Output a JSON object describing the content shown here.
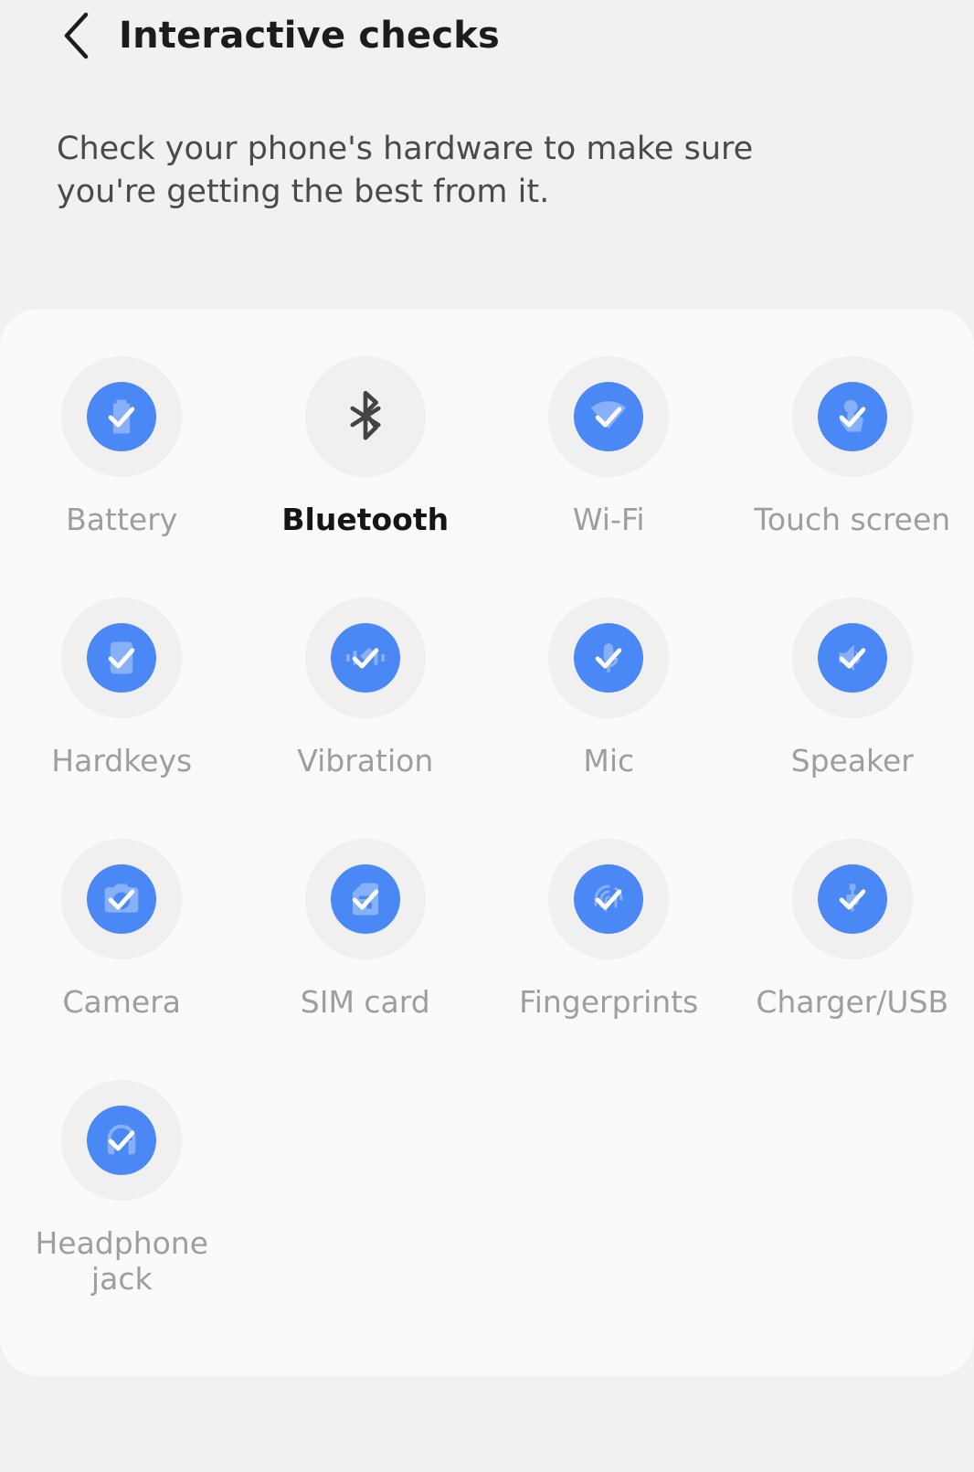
{
  "header": {
    "back_icon": "chevron-left-icon",
    "title": "Interactive checks"
  },
  "description": "Check your phone's hardware to make sure you're getting the best from it.",
  "colors": {
    "page_background": "#f1f1f1",
    "card_background": "#fafafa",
    "badge_blue": "#4a88f5",
    "disc_grey": "#f0f0f0",
    "label_done": "#9e9e9e",
    "label_pending": "#151515",
    "bluetooth_glyph": "#444444"
  },
  "checks": [
    {
      "label": "Battery",
      "icon": "battery-icon",
      "status": "done"
    },
    {
      "label": "Bluetooth",
      "icon": "bluetooth-icon",
      "status": "pending"
    },
    {
      "label": "Wi-Fi",
      "icon": "wifi-icon",
      "status": "done"
    },
    {
      "label": "Touch screen",
      "icon": "touch-screen-icon",
      "status": "done"
    },
    {
      "label": "Hardkeys",
      "icon": "hardkeys-icon",
      "status": "done"
    },
    {
      "label": "Vibration",
      "icon": "vibration-icon",
      "status": "done"
    },
    {
      "label": "Mic",
      "icon": "microphone-icon",
      "status": "done"
    },
    {
      "label": "Speaker",
      "icon": "speaker-icon",
      "status": "done"
    },
    {
      "label": "Camera",
      "icon": "camera-icon",
      "status": "done"
    },
    {
      "label": "SIM card",
      "icon": "sim-card-icon",
      "status": "done"
    },
    {
      "label": "Fingerprints",
      "icon": "fingerprint-icon",
      "status": "done"
    },
    {
      "label": "Charger/USB",
      "icon": "usb-icon",
      "status": "done"
    },
    {
      "label": "Headphone jack",
      "icon": "headphone-icon",
      "status": "done"
    }
  ]
}
